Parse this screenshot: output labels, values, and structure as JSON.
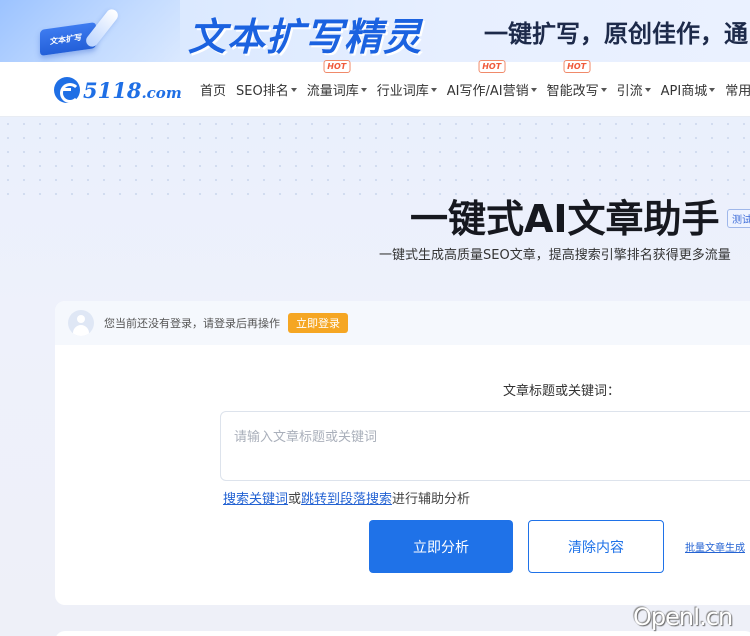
{
  "banner": {
    "card_text": "文本扩写",
    "title": "文本扩写精灵",
    "slogan": "一键扩写，原创佳作，通"
  },
  "logo": {
    "main": "5118",
    "suffix": ".com"
  },
  "nav": {
    "items": [
      {
        "label": "首页",
        "dropdown": false,
        "hot": false
      },
      {
        "label": "SEO排名",
        "dropdown": true,
        "hot": false
      },
      {
        "label": "流量词库",
        "dropdown": true,
        "hot": true
      },
      {
        "label": "行业词库",
        "dropdown": true,
        "hot": false
      },
      {
        "label": "AI写作/AI营销",
        "dropdown": true,
        "hot": true
      },
      {
        "label": "智能改写",
        "dropdown": true,
        "hot": true
      },
      {
        "label": "引流",
        "dropdown": true,
        "hot": false
      },
      {
        "label": "API商城",
        "dropdown": true,
        "hot": false
      },
      {
        "label": "常用",
        "dropdown": false,
        "hot": false
      }
    ],
    "hot_label": "HOT"
  },
  "hero": {
    "title": "一键式AI文章助手",
    "beta": "测试",
    "subtitle": "一键式生成高质量SEO文章，提高搜索引擎排名获得更多流量"
  },
  "card": {
    "login_text": "您当前还没有登录，请登录后再操作",
    "login_button": "立即登录",
    "field_label": "文章标题或关键词：",
    "input_placeholder": "请输入文章标题或关键词",
    "input_value": "",
    "helper_link1": "搜索关键词",
    "helper_mid": "或",
    "helper_link2": "跳转到段落搜索",
    "helper_tail": "进行辅助分析",
    "analyze_button": "立即分析",
    "clear_button": "清除内容",
    "batch_link": "批量文章生成"
  },
  "watermark": "OpenI.cn",
  "colors": {
    "primary": "#1f72e8",
    "login_button": "#f5a623",
    "hot": "#f05a3a",
    "banner_title": "#1b62e0"
  }
}
